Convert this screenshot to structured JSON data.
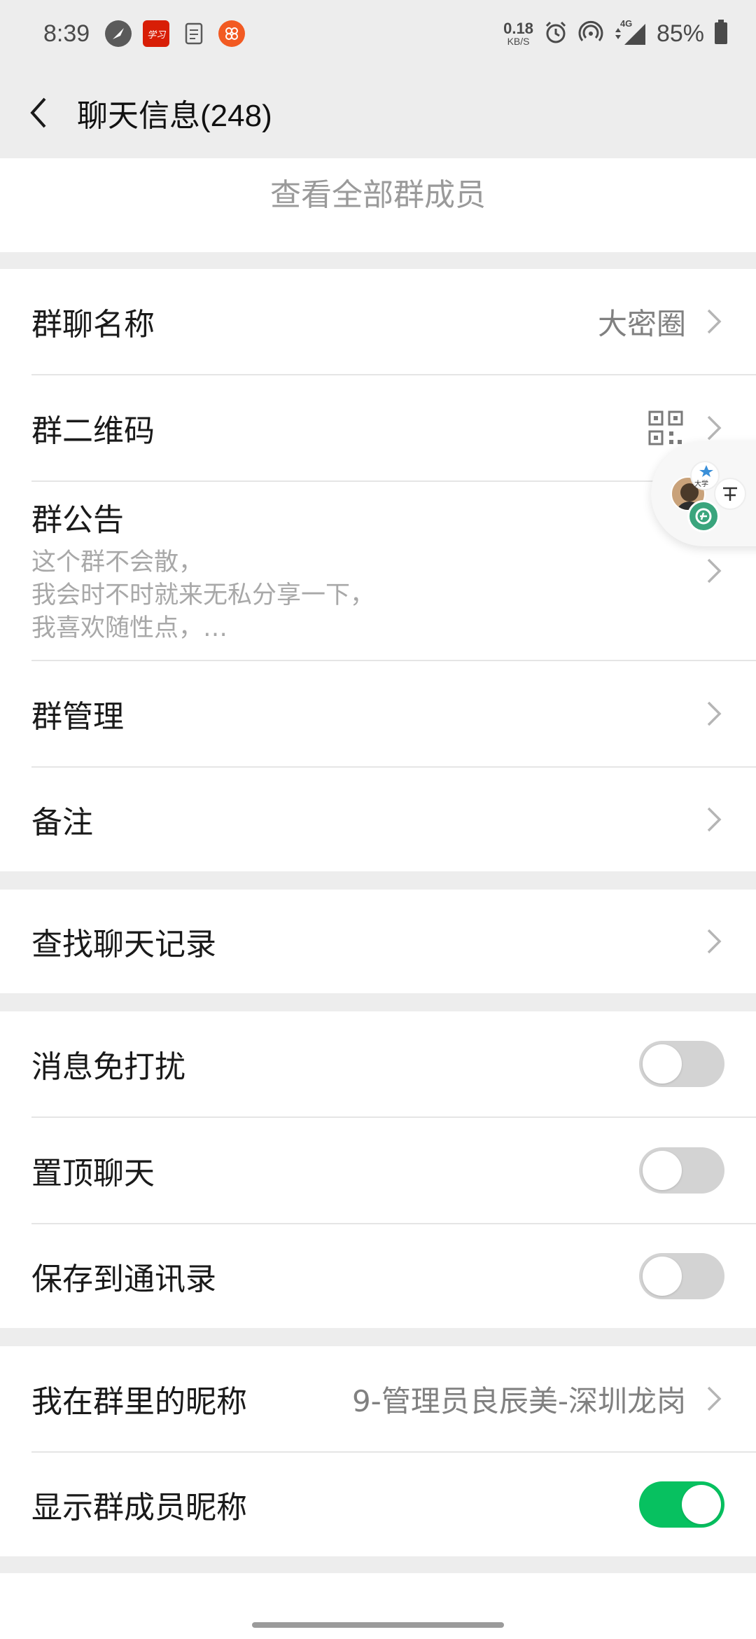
{
  "status_bar": {
    "time": "8:39",
    "net_speed_value": "0.18",
    "net_speed_unit": "KB/S",
    "network_badge": "4G",
    "battery_percent": "85%",
    "app_icon_xuexi_text": "学习"
  },
  "nav": {
    "title": "聊天信息(248)"
  },
  "members": {
    "see_all_label": "查看全部群成员"
  },
  "group_info": {
    "name_label": "群聊名称",
    "name_value": "大密圈",
    "qrcode_label": "群二维码",
    "announcement_label": "群公告",
    "announcement_lines": [
      "这个群不会散，",
      "我会时不时就来无私分享一下，",
      "我喜欢随性点，…"
    ],
    "manage_label": "群管理",
    "remark_label": "备注"
  },
  "search": {
    "history_label": "查找聊天记录"
  },
  "switches": {
    "mute_label": "消息免打扰",
    "mute_on": false,
    "pin_label": "置顶聊天",
    "pin_on": false,
    "save_contacts_label": "保存到通讯录",
    "save_contacts_on": false
  },
  "nickname": {
    "my_nickname_label": "我在群里的昵称",
    "my_nickname_value": "9-管理员良辰美-深圳龙岗",
    "show_nicknames_label": "显示群成员昵称",
    "show_nicknames_on": true
  },
  "floating_widget": {
    "text": "大学"
  },
  "colors": {
    "background": "#ededed",
    "card": "#ffffff",
    "accent_green": "#07c160",
    "secondary_text": "#808080"
  }
}
